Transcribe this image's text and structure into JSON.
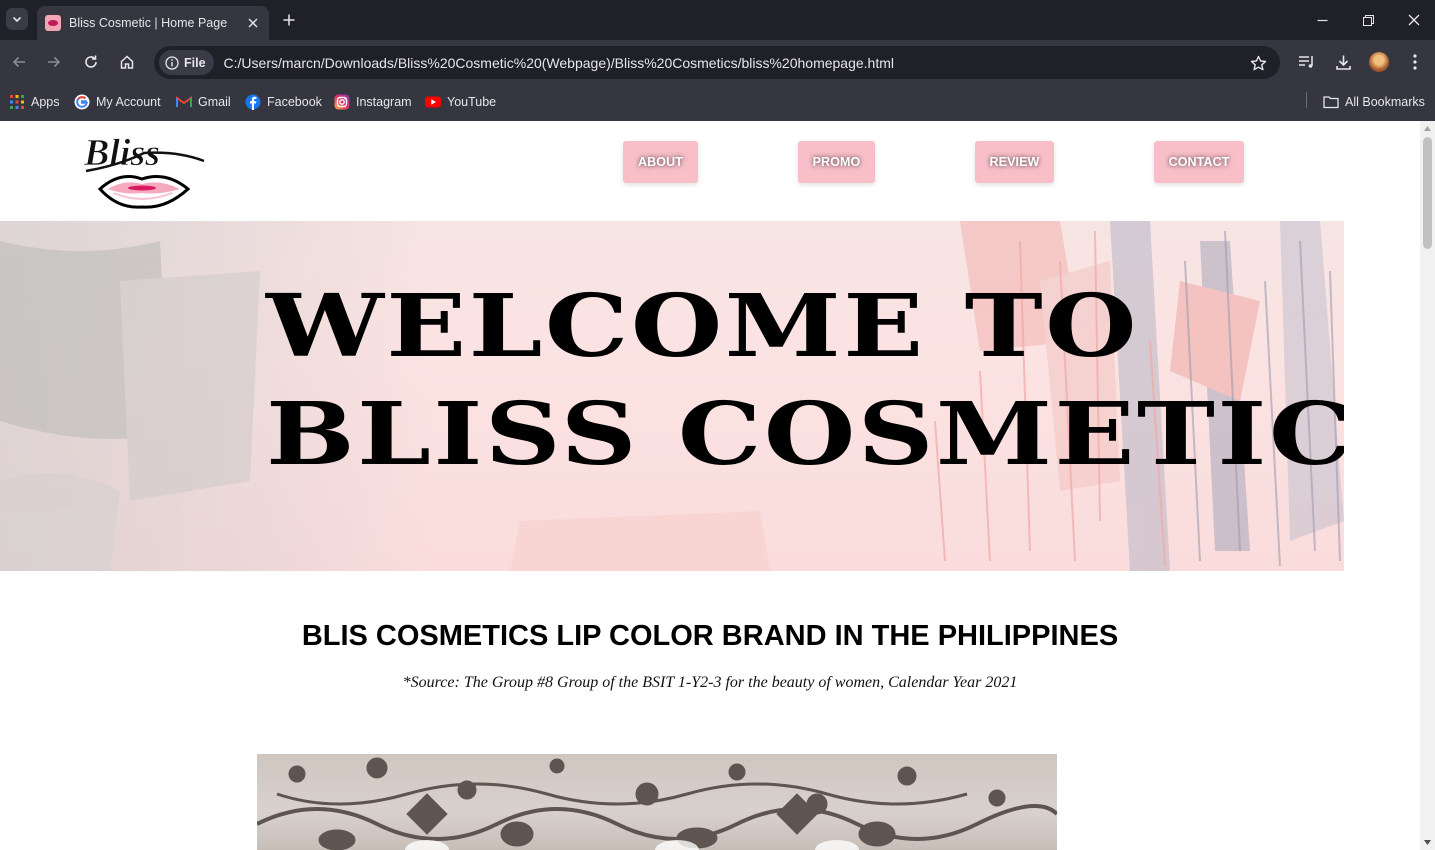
{
  "browser": {
    "tab_title": "Bliss Cosmetic | Home Page",
    "chip_label": "File",
    "url": "C:/Users/marcn/Downloads/Bliss%20Cosmetic%20(Webpage)/Bliss%20Cosmetics/bliss%20homepage.html",
    "bookmarks": {
      "apps": "Apps",
      "my_account": "My Account",
      "gmail": "Gmail",
      "facebook": "Facebook",
      "instagram": "Instagram",
      "youtube": "YouTube",
      "all_bookmarks": "All Bookmarks"
    }
  },
  "page": {
    "logo_text": "Bliss",
    "nav": {
      "about": "ABOUT",
      "promo": "PROMO",
      "review": "REVIEW",
      "contact": "CONTACT"
    },
    "hero": {
      "line1": "WELCOME TO",
      "line2": "BLISS COSMETICS"
    },
    "section_title": "BLIS COSMETICS LIP COLOR BRAND IN THE PHILIPPINES",
    "source_note": "*Source: The Group #8 Group of the BSIT 1-Y2-3 for the beauty of women, Calendar Year 2021"
  },
  "colors": {
    "nav_button": "#f8bfc9",
    "hero_bg": "#fbe3e2",
    "chrome_dark": "#1f2028",
    "chrome_mid": "#35363f"
  }
}
